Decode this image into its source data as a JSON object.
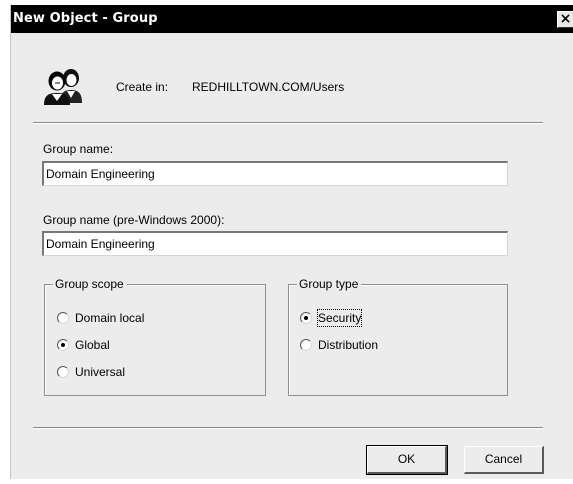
{
  "dialog": {
    "title": "New Object - Group",
    "close_glyph": "×"
  },
  "header": {
    "icon": "group-users-icon",
    "create_label": "Create in:",
    "create_path": "REDHILLTOWN.COM/Users"
  },
  "form": {
    "group_name_label": "Group name:",
    "group_name_value": "Domain Engineering",
    "pre2000_label": "Group name (pre-Windows 2000):",
    "pre2000_value": "Domain Engineering"
  },
  "group_scope": {
    "legend": "Group scope",
    "options": [
      {
        "label": "Domain local",
        "selected": false
      },
      {
        "label": "Global",
        "selected": true
      },
      {
        "label": "Universal",
        "selected": false
      }
    ]
  },
  "group_type": {
    "legend": "Group type",
    "options": [
      {
        "label": "Security",
        "selected": true,
        "focused": true
      },
      {
        "label": "Distribution",
        "selected": false
      }
    ]
  },
  "buttons": {
    "ok": "OK",
    "cancel": "Cancel"
  },
  "colors": {
    "title_bar": "#000000",
    "dialog_face": "#ececec",
    "field_background": "#ffffff"
  }
}
